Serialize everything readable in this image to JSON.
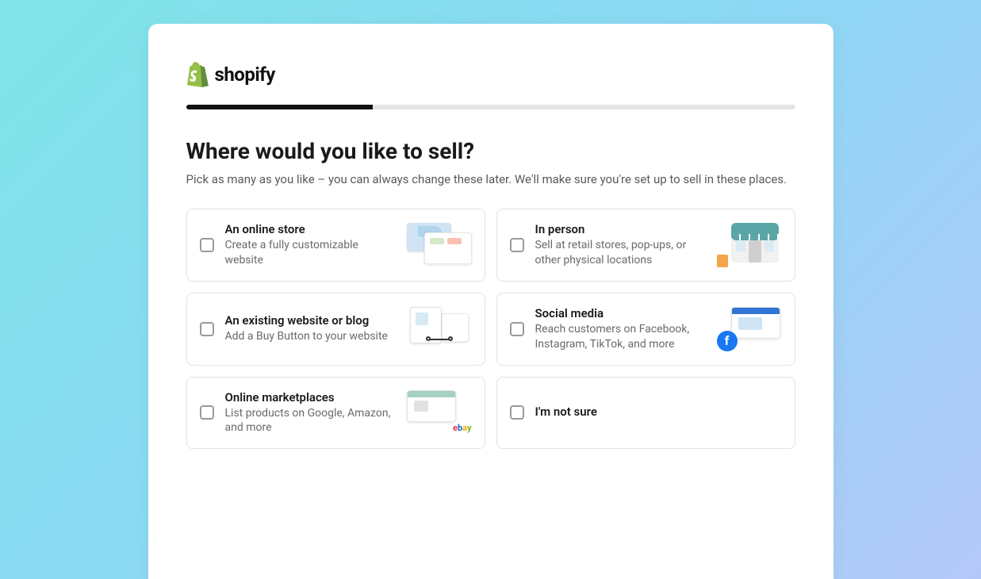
{
  "brand": {
    "name": "shopify"
  },
  "progress": {
    "percent": 30.7
  },
  "heading": "Where would you like to sell?",
  "subtitle": "Pick as many as you like – you can always change these later. We'll make sure you're set up to sell in these places.",
  "options": [
    {
      "title": "An online store",
      "desc": "Create a fully customizable website"
    },
    {
      "title": "In person",
      "desc": "Sell at retail stores, pop-ups, or other physical locations"
    },
    {
      "title": "An existing website or blog",
      "desc": "Add a Buy Button to your website"
    },
    {
      "title": "Social media",
      "desc": "Reach customers on Facebook, Instagram, TikTok, and more"
    },
    {
      "title": "Online marketplaces",
      "desc": "List products on Google, Amazon, and more"
    },
    {
      "title": "I'm not sure",
      "desc": ""
    }
  ]
}
